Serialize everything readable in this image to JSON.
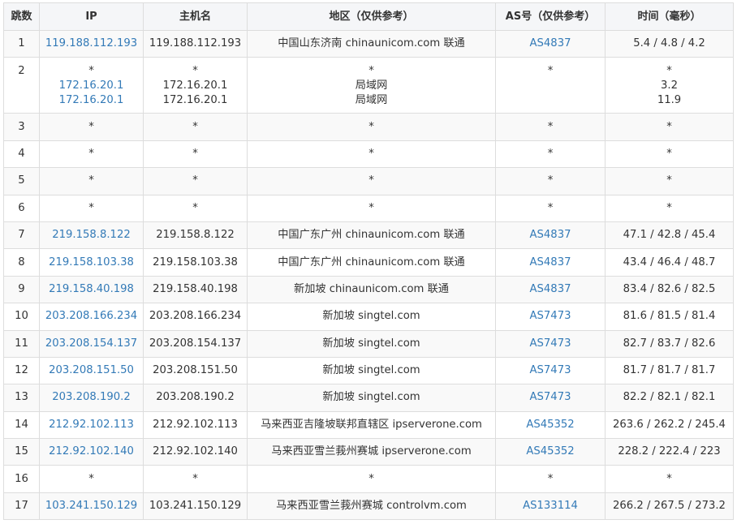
{
  "headers": [
    "跳数",
    "IP",
    "主机名",
    "地区（仅供参考）",
    "AS号（仅供参考）",
    "时间（毫秒）"
  ],
  "rows": [
    {
      "hop": "1",
      "ip": [
        "119.188.112.193"
      ],
      "host": [
        "119.188.112.193"
      ],
      "region": [
        "中国山东济南 chinaunicom.com 联通"
      ],
      "asn": [
        "AS4837"
      ],
      "time": [
        "5.4 / 4.8 / 4.2"
      ]
    },
    {
      "hop": "2",
      "ip": [
        "*",
        "172.16.20.1",
        "172.16.20.1"
      ],
      "host": [
        "*",
        "172.16.20.1",
        "172.16.20.1"
      ],
      "region": [
        "*",
        "局域网",
        "局域网"
      ],
      "asn": [
        "*"
      ],
      "time": [
        "*",
        "3.2",
        "11.9"
      ]
    },
    {
      "hop": "3",
      "ip": [
        "*"
      ],
      "host": [
        "*"
      ],
      "region": [
        "*"
      ],
      "asn": [
        "*"
      ],
      "time": [
        "*"
      ]
    },
    {
      "hop": "4",
      "ip": [
        "*"
      ],
      "host": [
        "*"
      ],
      "region": [
        "*"
      ],
      "asn": [
        "*"
      ],
      "time": [
        "*"
      ]
    },
    {
      "hop": "5",
      "ip": [
        "*"
      ],
      "host": [
        "*"
      ],
      "region": [
        "*"
      ],
      "asn": [
        "*"
      ],
      "time": [
        "*"
      ]
    },
    {
      "hop": "6",
      "ip": [
        "*"
      ],
      "host": [
        "*"
      ],
      "region": [
        "*"
      ],
      "asn": [
        "*"
      ],
      "time": [
        "*"
      ]
    },
    {
      "hop": "7",
      "ip": [
        "219.158.8.122"
      ],
      "host": [
        "219.158.8.122"
      ],
      "region": [
        "中国广东广州 chinaunicom.com 联通"
      ],
      "asn": [
        "AS4837"
      ],
      "time": [
        "47.1 / 42.8 / 45.4"
      ]
    },
    {
      "hop": "8",
      "ip": [
        "219.158.103.38"
      ],
      "host": [
        "219.158.103.38"
      ],
      "region": [
        "中国广东广州 chinaunicom.com 联通"
      ],
      "asn": [
        "AS4837"
      ],
      "time": [
        "43.4 / 46.4 / 48.7"
      ]
    },
    {
      "hop": "9",
      "ip": [
        "219.158.40.198"
      ],
      "host": [
        "219.158.40.198"
      ],
      "region": [
        "新加坡 chinaunicom.com 联通"
      ],
      "asn": [
        "AS4837"
      ],
      "time": [
        "83.4 / 82.6 / 82.5"
      ]
    },
    {
      "hop": "10",
      "ip": [
        "203.208.166.234"
      ],
      "host": [
        "203.208.166.234"
      ],
      "region": [
        "新加坡 singtel.com"
      ],
      "asn": [
        "AS7473"
      ],
      "time": [
        "81.6 / 81.5 / 81.4"
      ]
    },
    {
      "hop": "11",
      "ip": [
        "203.208.154.137"
      ],
      "host": [
        "203.208.154.137"
      ],
      "region": [
        "新加坡 singtel.com"
      ],
      "asn": [
        "AS7473"
      ],
      "time": [
        "82.7 / 83.7 / 82.6"
      ]
    },
    {
      "hop": "12",
      "ip": [
        "203.208.151.50"
      ],
      "host": [
        "203.208.151.50"
      ],
      "region": [
        "新加坡 singtel.com"
      ],
      "asn": [
        "AS7473"
      ],
      "time": [
        "81.7 / 81.7 / 81.7"
      ]
    },
    {
      "hop": "13",
      "ip": [
        "203.208.190.2"
      ],
      "host": [
        "203.208.190.2"
      ],
      "region": [
        "新加坡 singtel.com"
      ],
      "asn": [
        "AS7473"
      ],
      "time": [
        "82.2 / 82.1 / 82.1"
      ]
    },
    {
      "hop": "14",
      "ip": [
        "212.92.102.113"
      ],
      "host": [
        "212.92.102.113"
      ],
      "region": [
        "马来西亚吉隆坡联邦直辖区 ipserverone.com"
      ],
      "asn": [
        "AS45352"
      ],
      "time": [
        "263.6 / 262.2 / 245.4"
      ]
    },
    {
      "hop": "15",
      "ip": [
        "212.92.102.140"
      ],
      "host": [
        "212.92.102.140"
      ],
      "region": [
        "马来西亚雪兰莪州赛城 ipserverone.com"
      ],
      "asn": [
        "AS45352"
      ],
      "time": [
        "228.2 / 222.4 / 223"
      ]
    },
    {
      "hop": "16",
      "ip": [
        "*"
      ],
      "host": [
        "*"
      ],
      "region": [
        "*"
      ],
      "asn": [
        "*"
      ],
      "time": [
        "*"
      ]
    },
    {
      "hop": "17",
      "ip": [
        "103.241.150.129"
      ],
      "host": [
        "103.241.150.129"
      ],
      "region": [
        "马来西亚雪兰莪州赛城 controlvm.com"
      ],
      "asn": [
        "AS133114"
      ],
      "time": [
        "266.2 / 267.5 / 273.2"
      ]
    }
  ]
}
